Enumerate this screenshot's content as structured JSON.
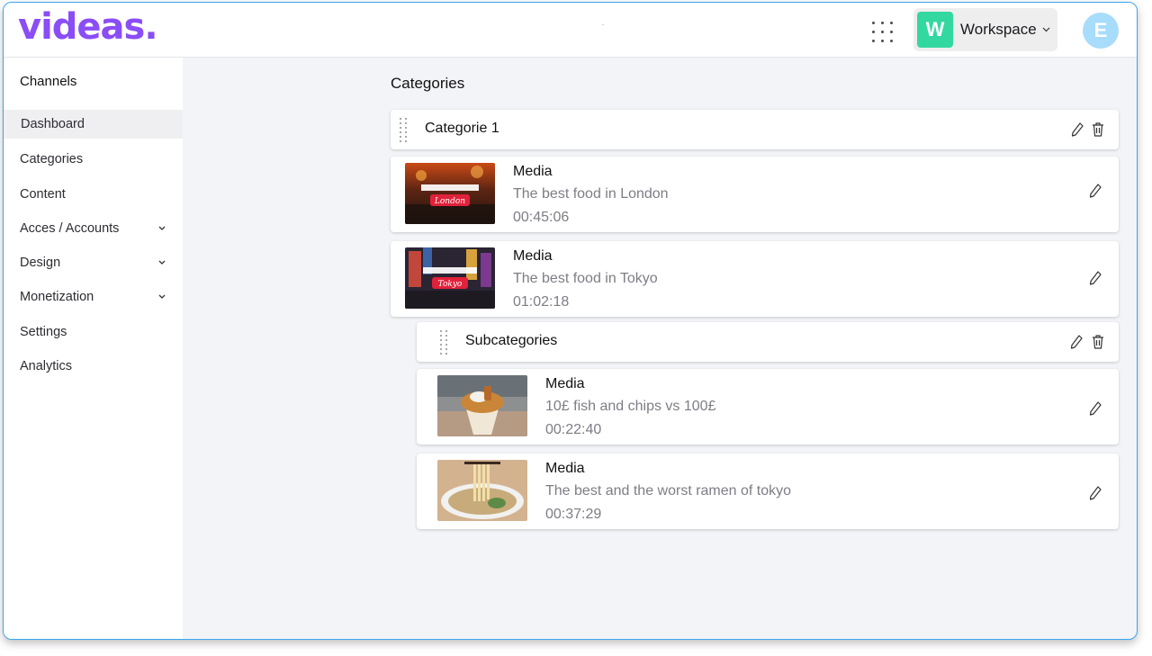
{
  "app": {
    "logo": "videas.",
    "workspace": {
      "badge": "W",
      "name": "Workspace"
    },
    "avatar": "E",
    "colors": {
      "accent": "#8a4df6",
      "workspace_badge": "#32d8a0",
      "avatar": "#a8dcfb",
      "frame_border": "#3aa6ee"
    }
  },
  "sidebar": {
    "title": "Channels",
    "items": [
      {
        "label": "Dashboard",
        "active": true
      },
      {
        "label": "Categories"
      },
      {
        "label": "Content"
      },
      {
        "label": "Acces / Accounts",
        "expandable": true
      },
      {
        "label": "Design",
        "expandable": true
      },
      {
        "label": "Monetization",
        "expandable": true
      },
      {
        "label": "Settings"
      },
      {
        "label": "Analytics"
      }
    ]
  },
  "main": {
    "title": "Categories",
    "category": {
      "name": "Categorie 1"
    },
    "media": [
      {
        "label": "Media",
        "title": "The best food in London",
        "duration": "00:45:06",
        "thumb_text": "London"
      },
      {
        "label": "Media",
        "title": "The best food in Tokyo",
        "duration": "01:02:18",
        "thumb_text": "Tokyo"
      }
    ],
    "subcategory": {
      "name": "Subcategories"
    },
    "sub_media": [
      {
        "label": "Media",
        "title": "10£ fish and chips vs 100£",
        "duration": "00:22:40"
      },
      {
        "label": "Media",
        "title": "The best and the worst ramen of tokyo",
        "duration": "00:37:29"
      }
    ]
  },
  "icons": [
    "apps-grid-icon",
    "chevron-down-icon",
    "drag-handle-icon",
    "pencil-icon",
    "trash-icon"
  ]
}
